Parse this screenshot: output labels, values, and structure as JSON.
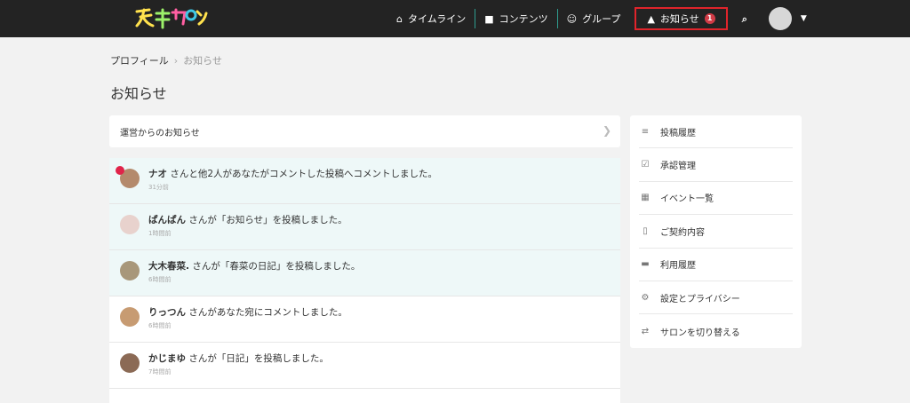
{
  "brand": {
    "logo_colors": [
      "#ffe14d",
      "#ff5fa2",
      "#3fc9e6",
      "#9cf06a"
    ]
  },
  "nav": {
    "timeline": {
      "label": "タイムライン",
      "icon": "home-icon"
    },
    "contents": {
      "label": "コンテンツ",
      "icon": "book-icon"
    },
    "groups": {
      "label": "グループ",
      "icon": "users-icon"
    },
    "notifications": {
      "label": "お知らせ",
      "icon": "bell-icon",
      "count": "1"
    },
    "search_icon": "search-icon"
  },
  "breadcrumb": {
    "parent": "プロフィール",
    "separator": "›",
    "current": "お知らせ"
  },
  "page": {
    "title": "お知らせ"
  },
  "announcement": {
    "label": "運営からのお知らせ"
  },
  "notifications": [
    {
      "name": "ナオ",
      "message": " さんと他2人があなたがコメントした投稿へコメントしました。",
      "time": "31分前",
      "unread": true,
      "avatar_color": "#b48a6c"
    },
    {
      "name": "ぱんぱん",
      "message": " さんが「お知らせ」を投稿しました。",
      "time": "1時間前",
      "unread": true,
      "avatar_color": "#e8d2cd"
    },
    {
      "name": "大木春菜.",
      "message": " さんが「春菜の日記」を投稿しました。",
      "time": "6時間前",
      "unread": true,
      "avatar_color": "#a8977a"
    },
    {
      "name": "りっつん",
      "message": " さんがあなた宛にコメントしました。",
      "time": "6時間前",
      "unread": false,
      "avatar_color": "#c79b72"
    },
    {
      "name": "かじまゆ",
      "message": " さんが「日記」を投稿しました。",
      "time": "7時間前",
      "unread": false,
      "avatar_color": "#8b6a55"
    }
  ],
  "sidebar": {
    "items": [
      {
        "label": "投稿履歴",
        "icon": "list-icon"
      },
      {
        "label": "承認管理",
        "icon": "check-square-icon"
      },
      {
        "label": "イベント一覧",
        "icon": "calendar-icon"
      },
      {
        "label": "ご契約内容",
        "icon": "clipboard-icon"
      },
      {
        "label": "利用履歴",
        "icon": "credit-card-icon"
      },
      {
        "label": "設定とプライバシー",
        "icon": "gear-icon"
      },
      {
        "label": "サロンを切り替える",
        "icon": "switch-icon"
      }
    ]
  }
}
